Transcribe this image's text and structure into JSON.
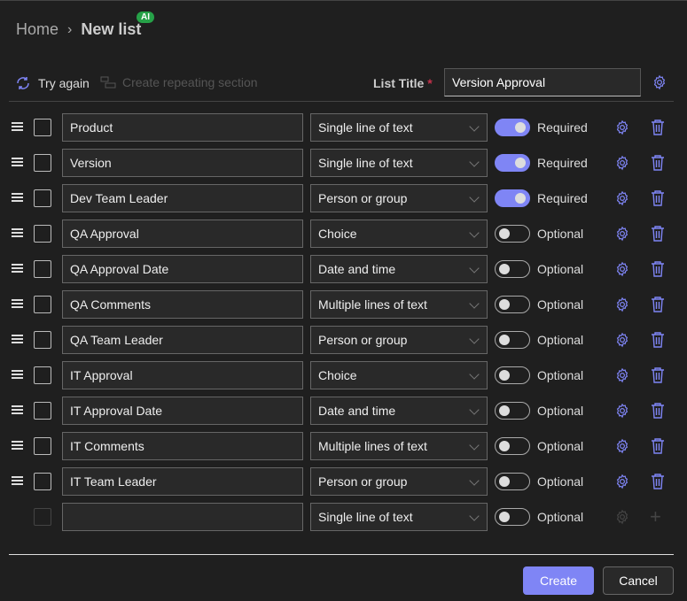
{
  "breadcrumb": {
    "home": "Home",
    "current": "New list",
    "badge": "AI"
  },
  "toolbar": {
    "try_again": "Try again",
    "repeating": "Create repeating section",
    "list_title_label": "List Title",
    "required_mark": "*",
    "list_title_value": "Version Approval"
  },
  "colors": {
    "accent": "#7f85f5",
    "background": "#1f1f1f",
    "ai_badge": "#26a148"
  },
  "columns": [
    {
      "name": "Product",
      "type": "Single line of text",
      "required": true,
      "label": "Required"
    },
    {
      "name": "Version",
      "type": "Single line of text",
      "required": true,
      "label": "Required"
    },
    {
      "name": "Dev Team Leader",
      "type": "Person or group",
      "required": true,
      "label": "Required"
    },
    {
      "name": "QA Approval",
      "type": "Choice",
      "required": false,
      "label": "Optional"
    },
    {
      "name": "QA Approval Date",
      "type": "Date and time",
      "required": false,
      "label": "Optional"
    },
    {
      "name": "QA Comments",
      "type": "Multiple lines of text",
      "required": false,
      "label": "Optional"
    },
    {
      "name": "QA Team Leader",
      "type": "Person or group",
      "required": false,
      "label": "Optional"
    },
    {
      "name": "IT Approval",
      "type": "Choice",
      "required": false,
      "label": "Optional"
    },
    {
      "name": "IT Approval Date",
      "type": "Date and time",
      "required": false,
      "label": "Optional"
    },
    {
      "name": "IT Comments",
      "type": "Multiple lines of text",
      "required": false,
      "label": "Optional"
    },
    {
      "name": "IT Team Leader",
      "type": "Person or group",
      "required": false,
      "label": "Optional"
    }
  ],
  "new_row": {
    "name": "",
    "type": "Single line of text",
    "required": false,
    "label": "Optional"
  },
  "footer": {
    "create": "Create",
    "cancel": "Cancel"
  }
}
